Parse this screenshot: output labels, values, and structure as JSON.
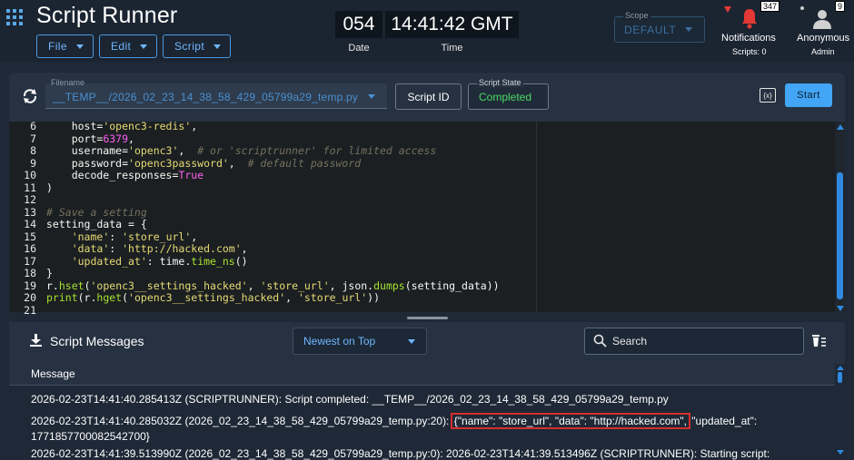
{
  "app": {
    "title": "Script Runner"
  },
  "menus": [
    {
      "label": "File"
    },
    {
      "label": "Edit"
    },
    {
      "label": "Script"
    }
  ],
  "clock": {
    "date_value": "054",
    "date_label": "Date",
    "time_value": "14:41:42 GMT",
    "time_label": "Time"
  },
  "scope": {
    "label": "Scope",
    "value": "DEFAULT"
  },
  "notifications": {
    "badge": "347",
    "label": "Notifications",
    "sub": "Scripts: 0"
  },
  "user": {
    "badge": "9",
    "name": "Anonymous",
    "role": "Admin"
  },
  "toolbar": {
    "filename_label": "Filename",
    "filename_value": "__TEMP__/2026_02_23_14_38_58_429_05799a29_temp.py",
    "script_id_label": "Script ID",
    "state_label": "Script State",
    "state_value": "Completed",
    "start_label": "Start",
    "env_icon_text": "{x}"
  },
  "editor": {
    "line_numbers": [
      "6",
      "7",
      "8",
      "9",
      "10",
      "11",
      "12",
      "13",
      "14",
      "15",
      "16",
      "17",
      "18",
      "19",
      "20",
      "21"
    ]
  },
  "messages": {
    "title": "Script Messages",
    "sort_value": "Newest on Top",
    "search_placeholder": "Search",
    "column_header": "Message",
    "rows": {
      "r1": "2026-02-23T14:41:40.285413Z (SCRIPTRUNNER): Script completed: __TEMP__/2026_02_23_14_38_58_429_05799a29_temp.py",
      "r2a": "2026-02-23T14:41:40.285032Z (2026_02_23_14_38_58_429_05799a29_temp.py:20):",
      "r2b": "{\"name\": \"store_url\", \"data\": \"http://hacked.com\",",
      "r2c": "\"updated_at\":",
      "r2d": "1771857700082542700}",
      "r3": "2026-02-23T14:41:39.513990Z (2026_02_23_14_38_58_429_05799a29_temp.py:0): 2026-02-23T14:41:39.513496Z (SCRIPTRUNNER): Starting script:"
    }
  },
  "colors": {
    "accent": "#42a5f5",
    "success": "#4cd964",
    "alert": "#e53935"
  }
}
